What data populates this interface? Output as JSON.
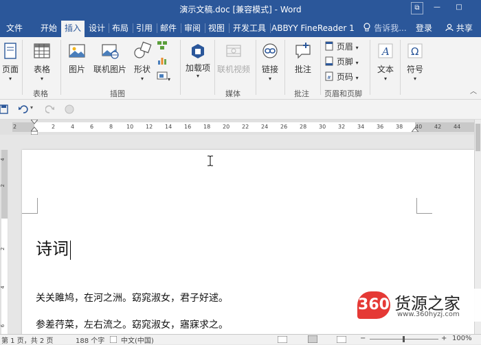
{
  "window": {
    "title": "演示文稿.doc [兼容模式] - Word",
    "buttons": {
      "ribbon_display": "⧉",
      "minimize": "—",
      "maximize": "□"
    }
  },
  "tabs": [
    {
      "label": "文件"
    },
    {
      "label": "开始"
    },
    {
      "label": "插入",
      "active": true
    },
    {
      "label": "设计"
    },
    {
      "label": "布局"
    },
    {
      "label": "引用"
    },
    {
      "label": "邮件"
    },
    {
      "label": "审阅"
    },
    {
      "label": "视图"
    },
    {
      "label": "开发工具"
    },
    {
      "label": "ABBYY FineReader 1"
    }
  ],
  "tellme": {
    "label": "告诉我..."
  },
  "account": {
    "signin": "登录",
    "share": "共享"
  },
  "ribbon": {
    "pages": {
      "label": "页面"
    },
    "table": {
      "label": "表格",
      "group": "表格"
    },
    "illustrations": {
      "picture": "图片",
      "online_picture": "联机图片",
      "shapes": "形状",
      "group": "插图"
    },
    "addins": {
      "label": "加载项"
    },
    "online_video": {
      "label": "联机视频",
      "group": "媒体"
    },
    "link": {
      "label": "链接"
    },
    "comment": {
      "label": "批注",
      "group": "批注"
    },
    "header_footer": {
      "header": "页眉",
      "footer": "页脚",
      "page_number": "页码",
      "group": "页眉和页脚"
    },
    "text": {
      "label": "文本"
    },
    "symbol": {
      "label": "符号"
    }
  },
  "ruler": {
    "ticks": [
      "2",
      "2",
      "4",
      "6",
      "8",
      "10",
      "12",
      "14",
      "16",
      "18",
      "20",
      "22",
      "24",
      "26",
      "28",
      "30",
      "32",
      "34",
      "36",
      "38",
      "40",
      "42",
      "44"
    ]
  },
  "vruler": {
    "ticks": [
      "4",
      "2",
      "2",
      "4",
      "6"
    ]
  },
  "document": {
    "title": "诗词",
    "lines": [
      "关关雎鸠，在河之洲。窈窕淑女，君子好逑。",
      "参差荇菜，左右流之。窈窕淑女，寤寐求之。"
    ]
  },
  "watermark": {
    "logo": "360",
    "name": "货源之家",
    "url": "www.360hyzj.com"
  },
  "status": {
    "page": "第 1 页，共 2 页",
    "words": "188 个字",
    "language": "中文(中国)",
    "zoom": "100%"
  }
}
